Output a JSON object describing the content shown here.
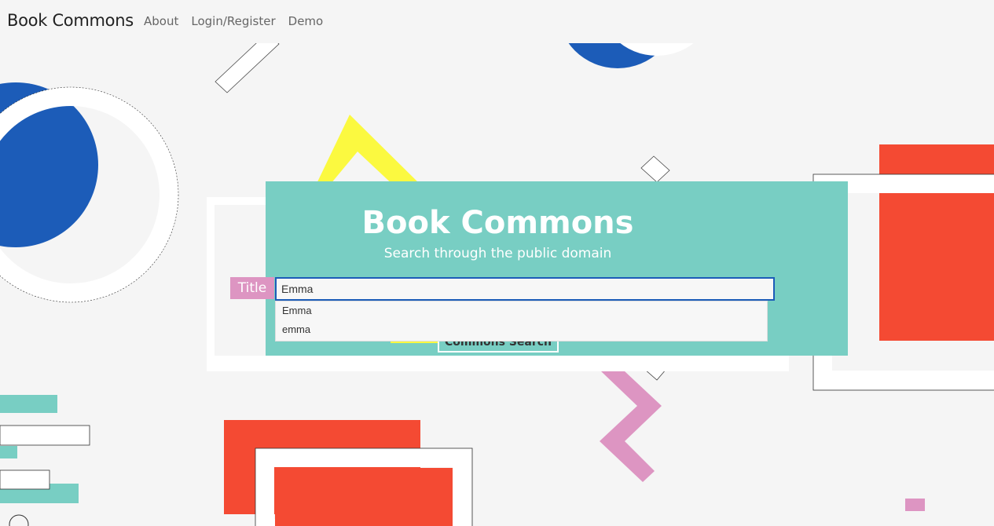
{
  "navbar": {
    "brand": "Book Commons",
    "links": [
      "About",
      "Login/Register",
      "Demo"
    ]
  },
  "hero": {
    "title": "Book Commons",
    "subtitle": "Search through the public domain",
    "field_label": "Title",
    "search_value": "Emma",
    "suggestions": [
      "Emma",
      "emma"
    ],
    "search_button": "Commons Search"
  },
  "colors": {
    "background": "#f5f5f5",
    "teal": "#78cec3",
    "blue": "#1c5cb8",
    "red": "#f44a33",
    "yellow": "#fbf940",
    "pink": "#dd95c2",
    "white": "#ffffff"
  }
}
